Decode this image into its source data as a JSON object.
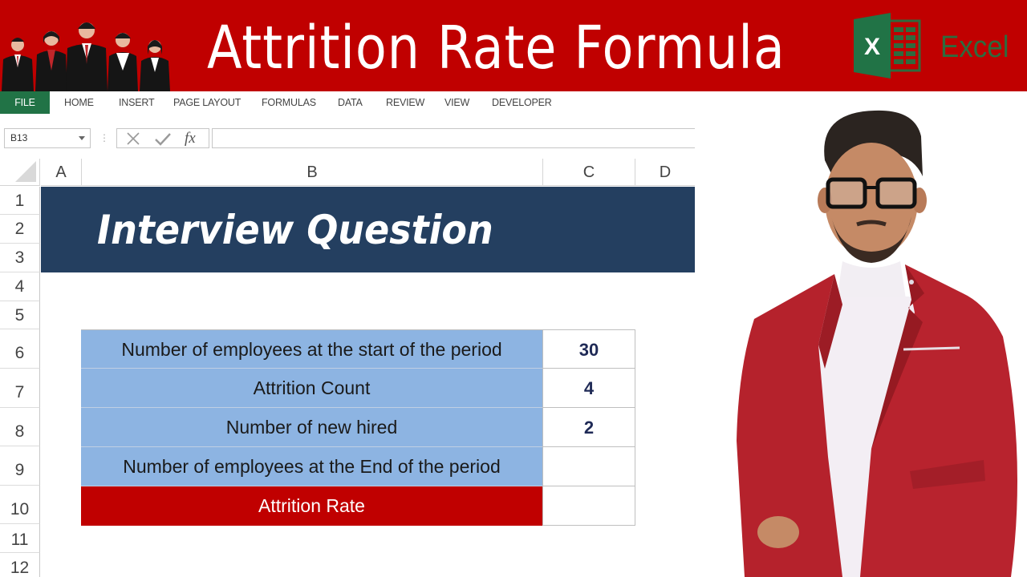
{
  "banner": {
    "title": "Attrition Rate Formula",
    "excel_logo_letter": "X",
    "excel_word": "Excel",
    "people_illustration": "business-team-illustration",
    "colors": {
      "background": "#c00000",
      "excel_green": "#217346"
    }
  },
  "ribbon": {
    "tabs": [
      {
        "label": "FILE",
        "active": true
      },
      {
        "label": "HOME"
      },
      {
        "label": "INSERT"
      },
      {
        "label": "PAGE LAYOUT"
      },
      {
        "label": "FORMULAS"
      },
      {
        "label": "DATA"
      },
      {
        "label": "REVIEW"
      },
      {
        "label": "VIEW"
      },
      {
        "label": "DEVELOPER"
      }
    ]
  },
  "formula_bar": {
    "name_box": "B13",
    "cancel_icon": "cross-icon",
    "enter_icon": "check-icon",
    "function_label": "fx",
    "formula_value": ""
  },
  "grid": {
    "columns": [
      "A",
      "B",
      "C",
      "D"
    ],
    "rows": [
      "1",
      "2",
      "3",
      "4",
      "5",
      "6",
      "7",
      "8",
      "9",
      "10",
      "11",
      "12"
    ],
    "header_banner": {
      "text": "Interview Question",
      "background": "#243f60"
    },
    "table": [
      {
        "label": "Number of employees at the start of the period",
        "value": "30"
      },
      {
        "label": "Attrition Count",
        "value": "4"
      },
      {
        "label": "Number of new hired",
        "value": "2"
      },
      {
        "label": "Number of employees at the End of the period",
        "value": ""
      },
      {
        "label": "Attrition Rate",
        "value": "",
        "highlight": true
      }
    ],
    "colors": {
      "label_fill": "#8db4e2",
      "highlight_fill": "#c00000",
      "value_text": "#1f2a56"
    }
  },
  "presenter": {
    "description": "presenter-photo"
  }
}
